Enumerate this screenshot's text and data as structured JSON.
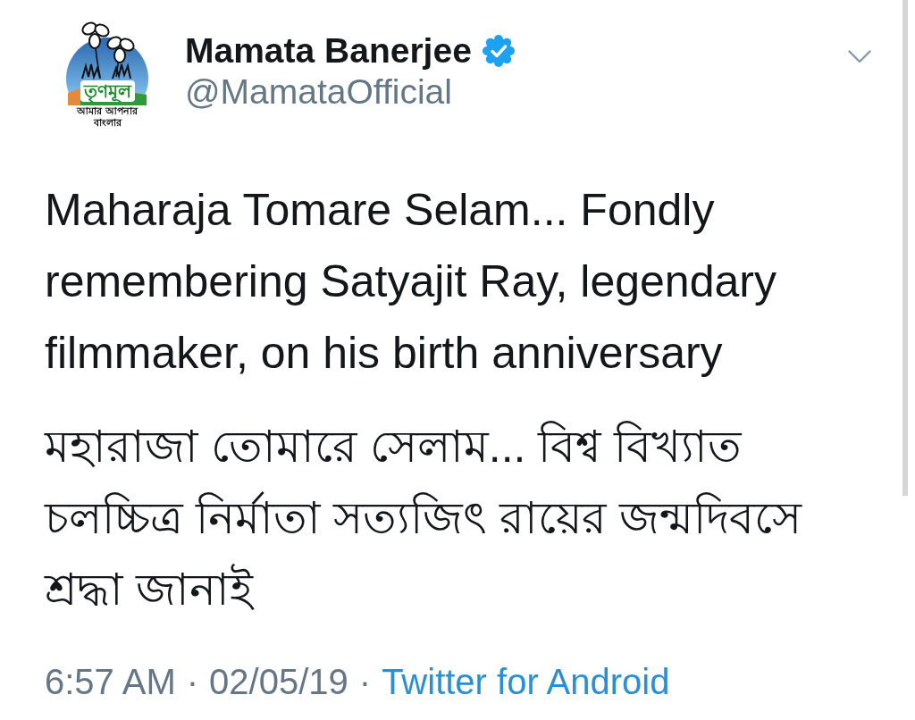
{
  "avatar": {
    "wordmark": "তৃণমূল",
    "tagline": "আমার আপনার বাংলার"
  },
  "author": {
    "name": "Mamata Banerjee",
    "verified": true,
    "handle": "@MamataOfficial"
  },
  "tweet_text": [
    "Maharaja Tomare Selam... Fondly remembering Satyajit Ray, legendary filmmaker, on his birth anniversary",
    "মহারাজা তোমারে সেলাম... বিশ্ব বিখ্যাত চলচ্চিত্র নির্মাতা সত্যজিৎ রায়ের জন্মদিবসে শ্রদ্ধা জানাই"
  ],
  "footer": [
    {
      "kind": "time",
      "text": "6:57 AM"
    },
    {
      "kind": "separator",
      "text": "·"
    },
    {
      "kind": "date",
      "text": "02/05/19"
    },
    {
      "kind": "separator",
      "text": "·"
    },
    {
      "kind": "source",
      "text": "Twitter for Android"
    }
  ]
}
